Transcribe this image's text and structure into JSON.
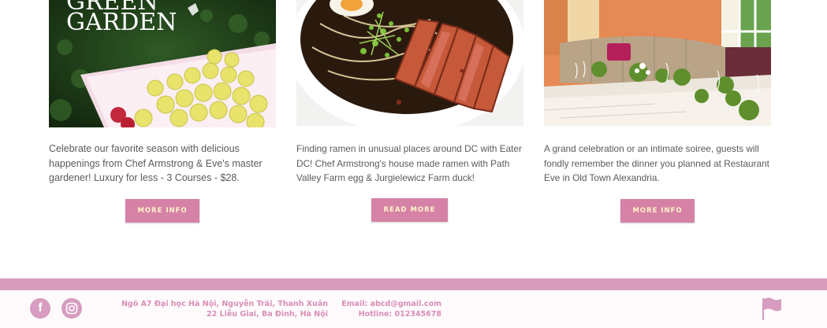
{
  "cards": [
    {
      "image_text": "GREEN\nGARDEN",
      "description": "Celebrate our favorite season with delicious happenings from Chef Armstrong & Eve's master gardener! Luxury for less - 3 Courses - $28.",
      "button_label": "MORE INFO"
    },
    {
      "description": "Finding ramen in unusual places around DC with Eater DC! Chef Armstrong's house made ramen with Path Valley Farm egg & Jurgielewicz Farm duck!",
      "button_label": "READ MORE"
    },
    {
      "description": "A grand celebration or an intimate soiree, guests will fondly remember the dinner you planned at Restaurant Eve in Old Town Alexandria.",
      "button_label": "MORE INFO"
    }
  ],
  "footer": {
    "social": [
      {
        "icon": "facebook-icon",
        "glyph": "f"
      },
      {
        "icon": "instagram-icon",
        "glyph": ""
      }
    ],
    "address_line1": "Ngõ A7 Đại học Hà Nội, Nguyễn Trãi, Thanh Xuân",
    "address_line2": "22 Liễu Giai, Ba Đình, Hà Nội",
    "email": "Email: abcd@gmail.com",
    "hotline": "Hotline: 012345678",
    "colors": {
      "accent": "#d681a6",
      "footer_bar": "#d69cba",
      "footer_text": "#d78fb4"
    }
  }
}
